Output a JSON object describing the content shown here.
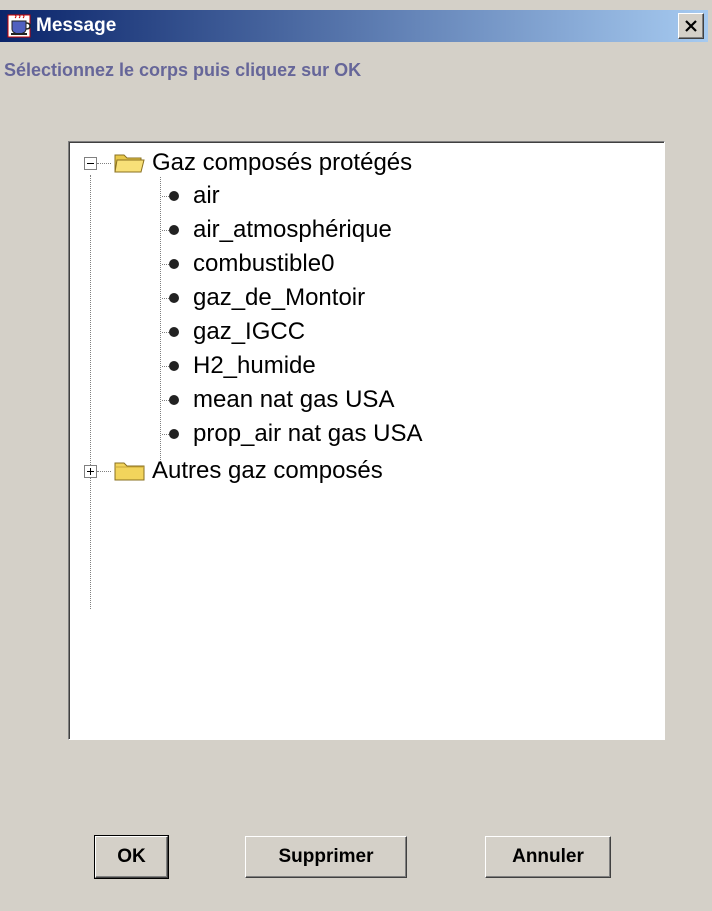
{
  "window": {
    "title": "Message",
    "prompt": "Sélectionnez le corps puis cliquez sur OK"
  },
  "tree": {
    "groups": [
      {
        "label": "Gaz composés protégés",
        "expanded": true,
        "items": [
          "air",
          "air_atmosphérique",
          "combustible0",
          "gaz_de_Montoir",
          "gaz_IGCC",
          "H2_humide",
          "mean nat gas USA",
          "prop_air nat gas USA"
        ]
      },
      {
        "label": "Autres gaz composés",
        "expanded": false,
        "items": []
      }
    ]
  },
  "buttons": {
    "ok": "OK",
    "delete": "Supprimer",
    "cancel": "Annuler"
  },
  "colors": {
    "title_bar_start": "#0a246a",
    "title_bar_end": "#a6caf0",
    "prompt_text": "#666699",
    "dialog_bg": "#d4d0c8"
  }
}
